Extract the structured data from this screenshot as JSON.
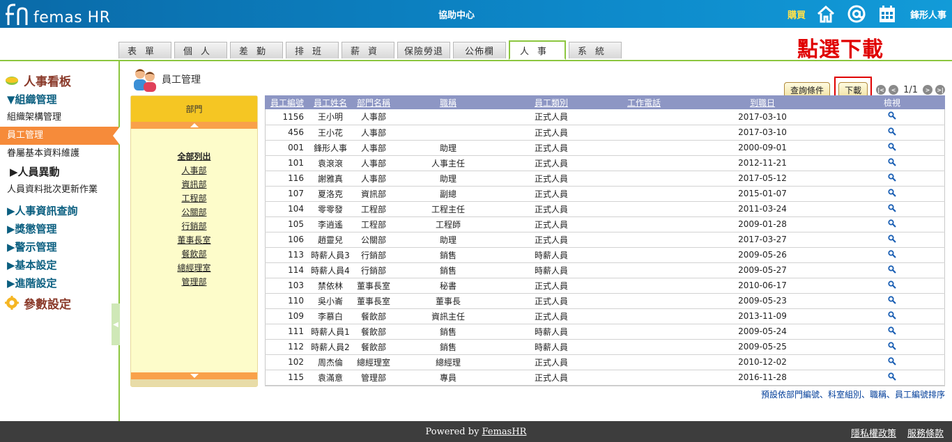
{
  "header": {
    "logo_text": "femas HR",
    "center_title": "協助中心",
    "buy_label": "購買",
    "user_name": "鋒形人事"
  },
  "tabs": [
    {
      "label": "表單",
      "active": false
    },
    {
      "label": "個人",
      "active": false
    },
    {
      "label": "差勤",
      "active": false
    },
    {
      "label": "排班",
      "active": false
    },
    {
      "label": "薪資",
      "active": false
    },
    {
      "label": "保險勞退",
      "active": false
    },
    {
      "label": "公佈欄",
      "active": false
    },
    {
      "label": "人事",
      "active": true
    },
    {
      "label": "系統",
      "active": false
    }
  ],
  "annotation": "點選下載",
  "sidebar": {
    "title": "人事看板",
    "org_group": "▼組織管理",
    "org_items": [
      "組織架構管理",
      "員工管理",
      "眷屬基本資料維護"
    ],
    "change_group": "▶人員異動",
    "batch_item": "人員資料批次更新作業",
    "groups": [
      "▶人事資訊查詢",
      "▶獎懲管理",
      "▶警示管理",
      "▶基本設定",
      "▶進階設定"
    ],
    "param_title": "參數設定"
  },
  "main": {
    "title": "員工管理",
    "query_button": "查詢條件",
    "download_button": "下載",
    "page_indicator": "1/1"
  },
  "departments": {
    "header": "部門",
    "all_label": "全部列出",
    "items": [
      "人事部",
      "資訊部",
      "工程部",
      "公關部",
      "行銷部",
      "董事長室",
      "餐飲部",
      "總經理室",
      "管理部"
    ]
  },
  "table": {
    "columns": [
      "員工編號",
      "員工姓名",
      "部門名稱",
      "職稱",
      "員工類別",
      "工作電話",
      "到職日",
      "檢視"
    ],
    "rows": [
      [
        "1156",
        "王小明",
        "人事部",
        "",
        "正式人員",
        "",
        "2017-03-10"
      ],
      [
        "456",
        "王小花",
        "人事部",
        "",
        "正式人員",
        "",
        "2017-03-10"
      ],
      [
        "001",
        "鋒形人事",
        "人事部",
        "助理",
        "正式人員",
        "",
        "2000-09-01"
      ],
      [
        "101",
        "袁滾滾",
        "人事部",
        "人事主任",
        "正式人員",
        "",
        "2012-11-21"
      ],
      [
        "116",
        "謝雅真",
        "人事部",
        "助理",
        "正式人員",
        "",
        "2017-05-12"
      ],
      [
        "107",
        "夏洛克",
        "資訊部",
        "副總",
        "正式人員",
        "",
        "2015-01-07"
      ],
      [
        "104",
        "零零發",
        "工程部",
        "工程主任",
        "正式人員",
        "",
        "2011-03-24"
      ],
      [
        "105",
        "李逍遙",
        "工程部",
        "工程師",
        "正式人員",
        "",
        "2009-01-28"
      ],
      [
        "106",
        "趙靈兒",
        "公關部",
        "助理",
        "正式人員",
        "",
        "2017-03-27"
      ],
      [
        "113",
        "時薪人員3",
        "行銷部",
        "銷售",
        "時薪人員",
        "",
        "2009-05-26"
      ],
      [
        "114",
        "時薪人員4",
        "行銷部",
        "銷售",
        "時薪人員",
        "",
        "2009-05-27"
      ],
      [
        "103",
        "禁依林",
        "董事長室",
        "秘書",
        "正式人員",
        "",
        "2010-06-17"
      ],
      [
        "110",
        "吳小崙",
        "董事長室",
        "董事長",
        "正式人員",
        "",
        "2009-05-23"
      ],
      [
        "109",
        "李慕白",
        "餐飲部",
        "資訊主任",
        "正式人員",
        "",
        "2013-11-09"
      ],
      [
        "111",
        "時薪人員1",
        "餐飲部",
        "銷售",
        "時薪人員",
        "",
        "2009-05-24"
      ],
      [
        "112",
        "時薪人員2",
        "餐飲部",
        "銷售",
        "時薪人員",
        "",
        "2009-05-25"
      ],
      [
        "102",
        "周杰倫",
        "總經理室",
        "總經理",
        "正式人員",
        "",
        "2010-12-02"
      ],
      [
        "115",
        "袁滿意",
        "管理部",
        "專員",
        "正式人員",
        "",
        "2016-11-28"
      ]
    ]
  },
  "sort_note": "預設依部門編號、科室組別、職稱、員工編號排序",
  "footer": {
    "powered_prefix": "Powered by ",
    "powered_link": "FemasHR",
    "privacy": "隱私權政策",
    "terms": "服務條款"
  },
  "colors": {
    "header_blue": "#0d88c9",
    "accent_green": "#8cc63f",
    "active_orange": "#f68b3a",
    "table_header": "#8d96c4",
    "annotation_red": "#e00000"
  }
}
